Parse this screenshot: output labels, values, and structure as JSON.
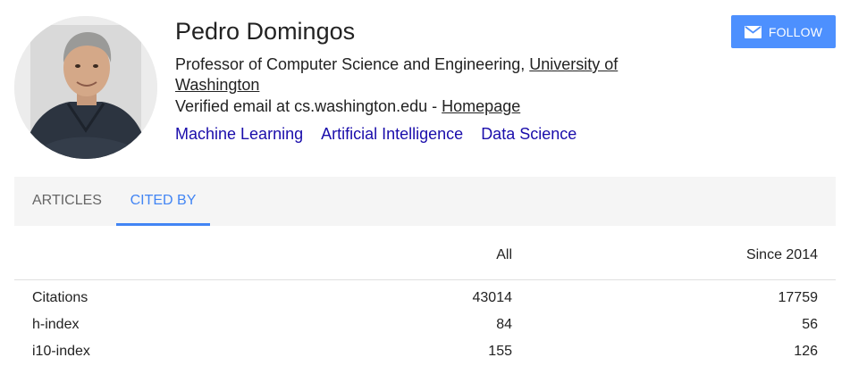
{
  "profile": {
    "name": "Pedro Domingos",
    "affiliation_prefix": "Professor of Computer Science and Engineering, ",
    "affiliation_link": "University of Washington",
    "email_text": "Verified email at cs.washington.edu - ",
    "homepage_label": "Homepage",
    "interests": [
      "Machine Learning",
      "Artificial Intelligence",
      "Data Science"
    ]
  },
  "follow": {
    "label": "FOLLOW",
    "icon": "envelope-icon"
  },
  "tabs": [
    {
      "label": "ARTICLES",
      "active": false
    },
    {
      "label": "CITED BY",
      "active": true
    }
  ],
  "citations": {
    "headers": [
      "",
      "All",
      "Since 2014"
    ],
    "rows": [
      {
        "label": "Citations",
        "all": "43014",
        "since": "17759"
      },
      {
        "label": "h-index",
        "all": "84",
        "since": "56"
      },
      {
        "label": "i10-index",
        "all": "155",
        "since": "126"
      }
    ]
  },
  "colors": {
    "accent": "#4285f4",
    "follow_button": "#4d90fe",
    "interest_link": "#1a0dab",
    "tab_bar": "#f5f5f5"
  }
}
